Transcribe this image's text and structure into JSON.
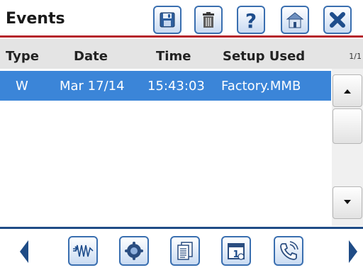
{
  "header": {
    "title": "Events",
    "toolbar": [
      {
        "icon": "save-icon"
      },
      {
        "icon": "trash-icon"
      },
      {
        "icon": "help-icon"
      },
      {
        "icon": "home-icon"
      },
      {
        "icon": "close-icon"
      }
    ]
  },
  "table": {
    "columns": [
      "Type",
      "Date",
      "Time",
      "Setup Used"
    ],
    "page_indicator": "1/1",
    "rows": [
      {
        "type": "W",
        "date": "Mar 17/14",
        "time": "15:43:03",
        "setup": "Factory.MMB",
        "selected": true
      }
    ]
  },
  "bottom_toolbar": [
    {
      "icon": "arrow-left-icon"
    },
    {
      "icon": "waveform-icon"
    },
    {
      "icon": "measurement-icon"
    },
    {
      "icon": "documents-icon"
    },
    {
      "icon": "calendar-icon"
    },
    {
      "icon": "phone-icon"
    },
    {
      "icon": "arrow-right-icon"
    }
  ],
  "colors": {
    "accent_red": "#b5262b",
    "selection_blue": "#3b85d8",
    "button_border": "#3a6fb0"
  }
}
